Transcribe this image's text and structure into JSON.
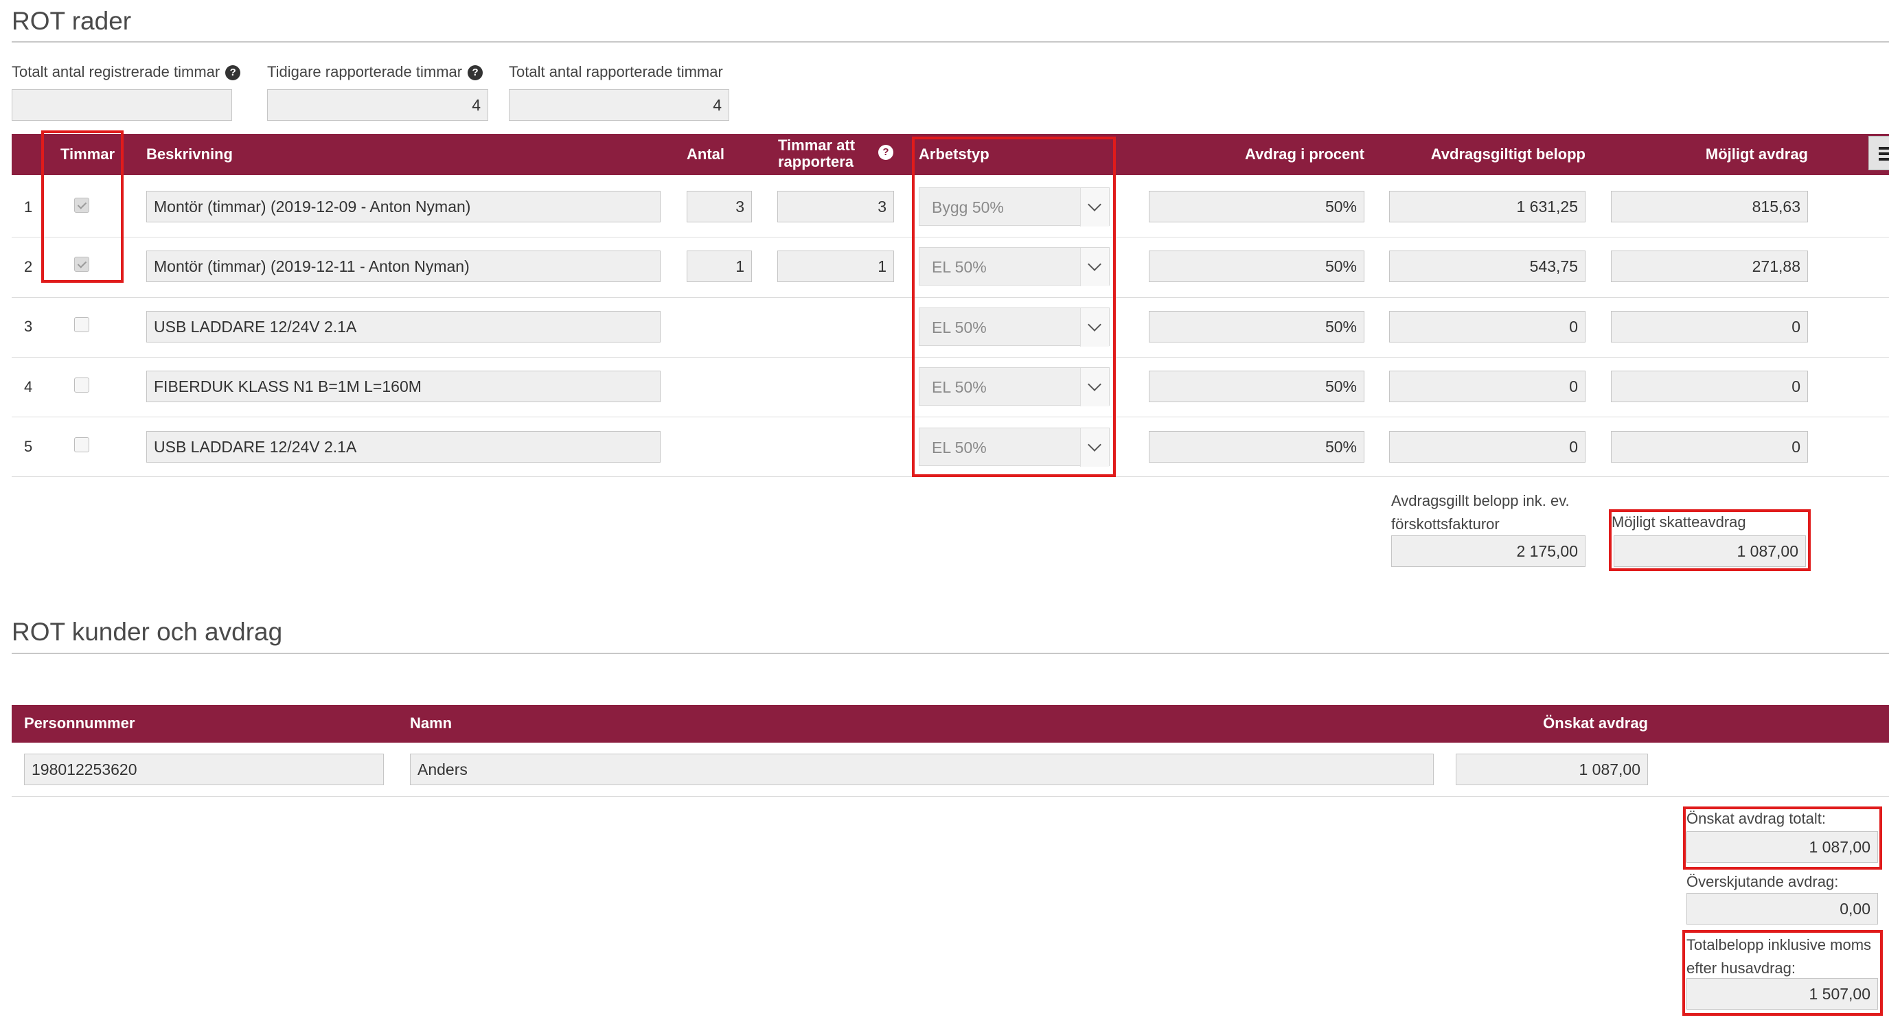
{
  "rot_rader": {
    "title": "ROT rader",
    "summary": {
      "total_registered_label": "Totalt antal registrerade timmar",
      "total_registered_value": "",
      "previous_reported_label": "Tidigare rapporterade timmar",
      "previous_reported_value": "4",
      "total_reported_label": "Totalt antal rapporterade timmar",
      "total_reported_value": "4"
    },
    "columns": {
      "hours": "Timmar",
      "description": "Beskrivning",
      "quantity": "Antal",
      "hours_to_report_1": "Timmar att",
      "hours_to_report_2": "rapportera",
      "work_type": "Arbetstyp",
      "deduction_percent": "Avdrag i procent",
      "deductible_amount": "Avdragsgiltigt belopp",
      "possible_deduction": "Möjligt avdrag"
    },
    "rows": [
      {
        "num": "1",
        "description": "Montör (timmar) (2019-12-09 - Anton Nyman)",
        "quantity": "3",
        "hours_to_report": "3",
        "work_type": "Bygg 50%",
        "percent": "50%",
        "deductible": "1 631,25",
        "possible": "815,63"
      },
      {
        "num": "2",
        "description": "Montör (timmar) (2019-12-11 - Anton Nyman)",
        "quantity": "1",
        "hours_to_report": "1",
        "work_type": "EL 50%",
        "percent": "50%",
        "deductible": "543,75",
        "possible": "271,88"
      },
      {
        "num": "3",
        "description": "USB LADDARE 12/24V 2.1A",
        "work_type": "EL 50%",
        "percent": "50%",
        "deductible": "0",
        "possible": "0"
      },
      {
        "num": "4",
        "description": "FIBERDUK KLASS N1 B=1M L=160M",
        "work_type": "EL 50%",
        "percent": "50%",
        "deductible": "0",
        "possible": "0"
      },
      {
        "num": "5",
        "description": "USB LADDARE 12/24V 2.1A",
        "work_type": "EL 50%",
        "percent": "50%",
        "deductible": "0",
        "possible": "0"
      }
    ],
    "totals": {
      "deductible_label_1": "Avdragsgillt belopp ink. ev.",
      "deductible_label_2": "förskottsfakturor",
      "deductible_value": "2 175,00",
      "possible_tax_label": "Möjligt skatteavdrag",
      "possible_tax_value": "1 087,00"
    }
  },
  "rot_kunder": {
    "title": "ROT kunder och avdrag",
    "columns": {
      "personnummer": "Personnummer",
      "name": "Namn",
      "requested": "Önskat avdrag"
    },
    "row": {
      "personnummer": "198012253620",
      "name": "Anders",
      "requested": "1 087,00"
    },
    "summary": {
      "requested_total_label": "Önskat avdrag totalt:",
      "requested_total_value": "1 087,00",
      "excess_label": "Överskjutande avdrag:",
      "excess_value": "0,00",
      "total_label_1": "Totalbelopp inklusive moms",
      "total_label_2": "efter husavdrag:",
      "total_value": "1 507,00"
    }
  },
  "colors": {
    "header_bar": "#8b1e3f",
    "highlight": "#e01b1b"
  },
  "icons": [
    "help-icon",
    "hamburger-menu-icon",
    "chevron-down-icon",
    "checkbox-checked-icon"
  ]
}
